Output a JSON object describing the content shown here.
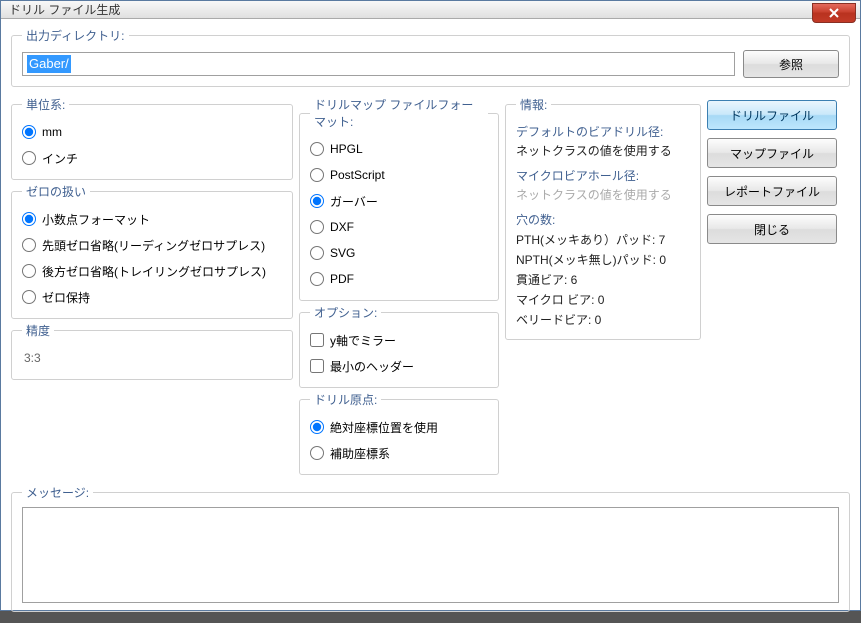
{
  "window": {
    "title": "ドリル ファイル生成"
  },
  "outputDir": {
    "legend": "出力ディレクトリ:",
    "value": "Gaber/",
    "browse": "参照"
  },
  "units": {
    "legend": "単位系:",
    "mm": "mm",
    "inch": "インチ"
  },
  "zeros": {
    "legend": "ゼロの扱い",
    "decimal": "小数点フォーマット",
    "leading": "先頭ゼロ省略(リーディングゼロサプレス)",
    "trailing": "後方ゼロ省略(トレイリングゼロサプレス)",
    "keep": "ゼロ保持"
  },
  "precision": {
    "legend": "精度",
    "value": "3:3"
  },
  "mapFormat": {
    "legend": "ドリルマップ ファイルフォーマット:",
    "hpgl": "HPGL",
    "ps": "PostScript",
    "gerber": "ガーバー",
    "dxf": "DXF",
    "svg": "SVG",
    "pdf": "PDF"
  },
  "options": {
    "legend": "オプション:",
    "mirrorY": "y軸でミラー",
    "minHeader": "最小のヘッダー"
  },
  "origin": {
    "legend": "ドリル原点:",
    "absolute": "絶対座標位置を使用",
    "aux": "補助座標系"
  },
  "info": {
    "legend": "情報:",
    "viaDrillLabel": "デフォルトのビアドリル径:",
    "viaDrillValue": "ネットクラスの値を使用する",
    "microViaLabel": "マイクロビアホール径:",
    "microViaValue": "ネットクラスの値を使用する",
    "holesLabel": "穴の数:",
    "pth": "PTH(メッキあり）パッド: 7",
    "npth": "NPTH(メッキ無し)パッド: 0",
    "throughVia": "貫通ビア: 6",
    "microVia2": "マイクロ ビア: 0",
    "buriedVia": "ベリードビア: 0"
  },
  "buttons": {
    "drill": "ドリルファイル",
    "map": "マップファイル",
    "report": "レポートファイル",
    "close": "閉じる"
  },
  "messages": {
    "legend": "メッセージ:"
  }
}
